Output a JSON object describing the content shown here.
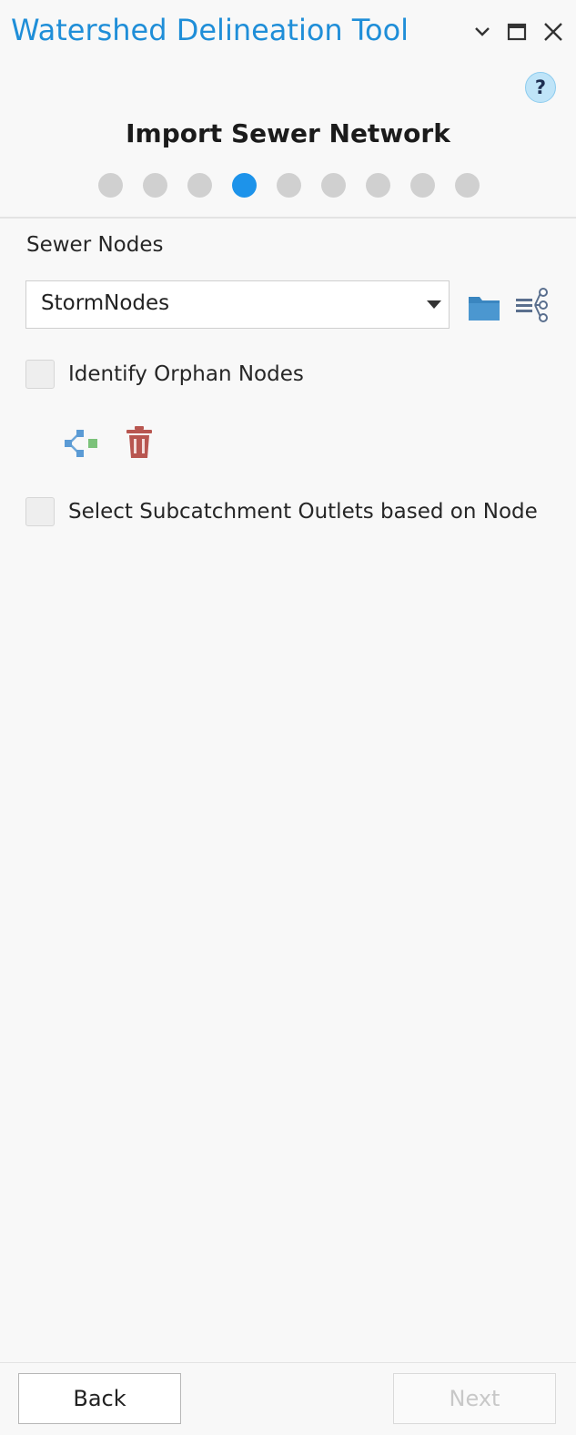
{
  "window": {
    "title": "Watershed Delineation Tool",
    "controls": [
      "chevron-down-icon",
      "maximize-icon",
      "close-icon"
    ]
  },
  "help": {
    "label": "?"
  },
  "wizard": {
    "step_title": "Import Sewer Network",
    "total_steps": 9,
    "current_step": 4
  },
  "sewer_nodes": {
    "label": "Sewer Nodes",
    "selected": "StormNodes",
    "icons": [
      "folder-icon",
      "attribute-table-icon"
    ]
  },
  "options": {
    "identify_orphans": {
      "label": "Identify Orphan Nodes",
      "checked": false
    },
    "orphan_tools": [
      "orphan-node-icon",
      "trash-icon"
    ],
    "select_outlets": {
      "label": "Select Subcatchment Outlets based on Node ",
      "checked": false
    }
  },
  "footer": {
    "back_label": "Back",
    "next_label": "Next",
    "next_enabled": false
  },
  "colors": {
    "accent": "#1d93ea",
    "title": "#1f8ed8",
    "inactive_dot": "#d0d0d0",
    "trash": "#b85650",
    "folder": "#3a86c0"
  }
}
